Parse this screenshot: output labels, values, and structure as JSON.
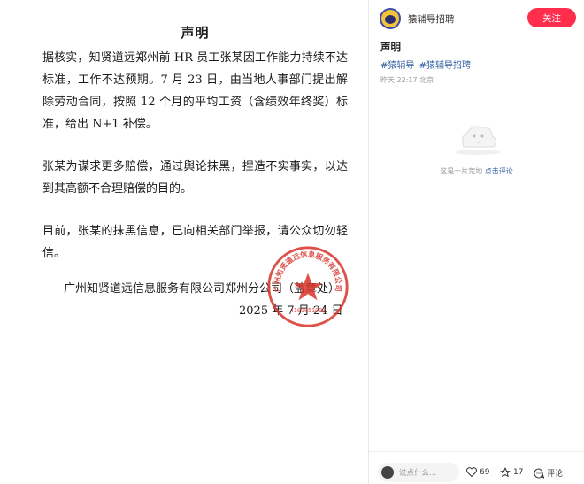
{
  "document": {
    "title": "声明",
    "paragraphs": [
      "据核实，知贤道远郑州前 HR 员工张某因工作能力持续不达标准，工作不达预期。7 月 23 日，由当地人事部门提出解除劳动合同，按照 12 个月的平均工资（含绩效年终奖）标准，给出 N+1 补偿。",
      "张某为谋求更多赔偿，通过舆论抹黑，捏造不实事实，以达到其高额不合理赔偿的目的。",
      "目前，张某的抹黑信息，已向相关部门举报，请公众切勿轻信。"
    ],
    "signature_company": "广州知贤道远信息服务有限公司郑州分公司（盖章处）",
    "signature_date": "2025 年 7 月 24 日",
    "stamp_text": "广州知贤道远信息服务有限公司郑州分公司",
    "stamp_number": "4101051000"
  },
  "sidebar": {
    "author_name": "猿辅导招聘",
    "follow_label": "关注",
    "post_title": "声明",
    "tags": [
      "#猿辅导",
      "#猿辅导招聘"
    ],
    "meta": "昨天 22:17 北京",
    "empty_text": "这是一片荒地",
    "empty_link": "点击评论",
    "comment_placeholder": "说点什么...",
    "likes": "69",
    "stars": "17",
    "comment_label": "评论"
  },
  "colors": {
    "accent": "#ff2e4d",
    "tag": "#2f5d9e",
    "stamp": "#d8332a"
  }
}
